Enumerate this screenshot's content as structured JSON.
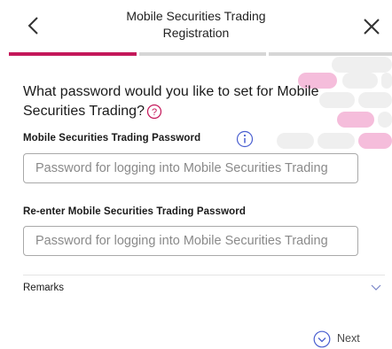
{
  "header": {
    "title_line1": "Mobile Securities Trading",
    "title_line2": "Registration"
  },
  "progress": {
    "current_step": 1,
    "total_steps": 3
  },
  "question": {
    "text": "What password would you like to set for Mobile Securities Trading?"
  },
  "fields": {
    "password_label": "Mobile Securities Trading Password",
    "password_placeholder": "Password for logging into Mobile Securities Trading",
    "reenter_label": "Re-enter Mobile Securities Trading Password",
    "reenter_placeholder": "Password for logging into Mobile Securities Trading"
  },
  "remarks": {
    "label": "Remarks"
  },
  "footer": {
    "next_label": "Next"
  },
  "colors": {
    "accent": "#c4185a",
    "progress_inactive": "#d6d6d6",
    "decor_pink": "#f5bddb",
    "decor_grey": "#efefef"
  }
}
